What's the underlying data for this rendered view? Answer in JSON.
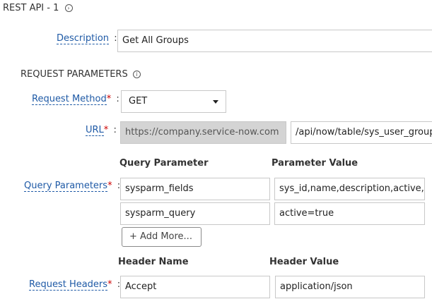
{
  "header": {
    "title": "REST API - 1",
    "chevron_glyph": "›"
  },
  "description": {
    "label": "Description",
    "value": "Get All Groups"
  },
  "request_parameters": {
    "title": "REQUEST PARAMETERS",
    "info_glyph": "i"
  },
  "request_method": {
    "label": "Request Method",
    "value": "GET"
  },
  "url": {
    "label": "URL",
    "base": "https://company.service-now.com",
    "path": "/api/now/table/sys_user_group"
  },
  "query_parameters": {
    "label": "Query Parameters",
    "col_name": "Query Parameter",
    "col_value": "Parameter Value",
    "rows": [
      {
        "name": "sysparm_fields",
        "value": "sys_id,name,description,active,sys_created_on"
      },
      {
        "name": "sysparm_query",
        "value": "active=true"
      }
    ],
    "add_more": "+ Add More..."
  },
  "request_headers": {
    "label": "Request Headers",
    "col_name": "Header Name",
    "col_value": "Header Value",
    "rows": [
      {
        "name": "Accept",
        "value": "application/json"
      }
    ]
  },
  "required_marker": "*",
  "colon": ":"
}
